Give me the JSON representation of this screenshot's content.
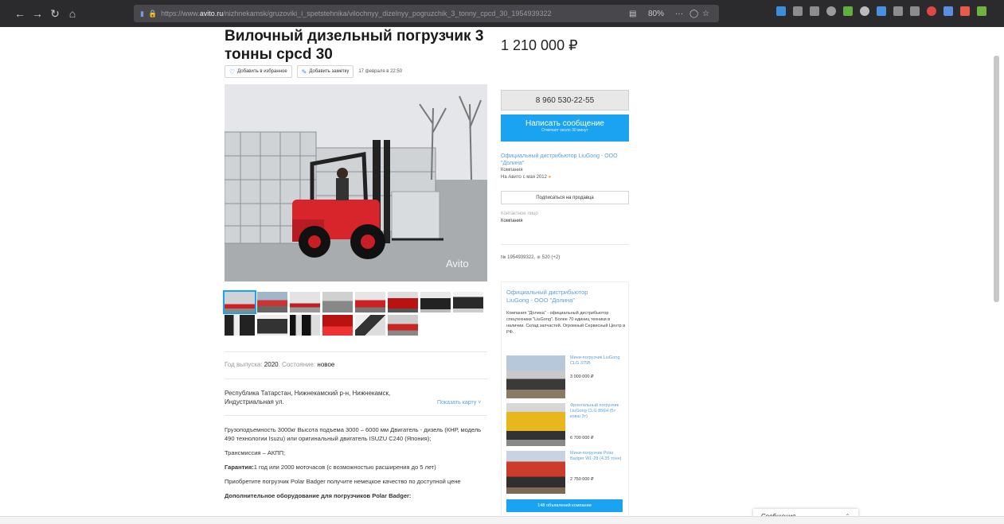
{
  "browser": {
    "url_prefix": "https://www.",
    "url_domain": "avito.ru",
    "url_rest": "/nizhnekamsk/gruzoviki_i_spetstehnika/vilochnyy_dizelnyy_pogruzchik_3_tonny_cpcd_30_1954939322",
    "zoom": "80%",
    "menu": "···"
  },
  "listing": {
    "title": "Вилочный дизельный погрузчик 3 тонны cpcd 30",
    "price": "1 210 000 ₽",
    "favorite_label": "Добавить в избранное",
    "note_label": "Добавить заметку",
    "date": "17 февраля в 22:50",
    "watermark": "Avito",
    "specs": {
      "year_label": "Год выпуска:",
      "year_value": "2020",
      "condition_label": "Состояние:",
      "condition_value": "новое"
    },
    "address": "Республика Татарстан, Нижнекамский р-н, Нижнекамск, Индустриальная ул.",
    "map_link": "Показать карту",
    "description": [
      "Грузоподъемность 3000кг Высота подъема 3000 – 6000 мм Двигатель - дизель (КНР, модель 490 технологии Isuzu) или оригинальный двигатель ISUZU C240 (Япония);",
      "Трансмиссия – АКПП;",
      "1 год или 2000 моточасов (с возможностью расширения до 5 лет)",
      "Приобретите погрузчик Polar Badger получите немецкое качество по доступной цене",
      "Дополнительное оборудование для погрузчиков Polar Badger:"
    ],
    "warranty_label": "Гарантия:"
  },
  "seller": {
    "phone": "8 960 530-22-55",
    "message_button": "Написать сообщение",
    "message_sub": "Отвечает около 30 минут",
    "name": "Официальный дистрибьютор LiuGong - ООО \"Долина\"",
    "type": "Компания",
    "since": "На Авито с мая 2012",
    "subscribe": "Подписаться на продавца",
    "contact_label": "Контактное лицо",
    "contact_value": "Компания",
    "ad_number": "№ 1954939322,",
    "views": "520 (+2)"
  },
  "promo": {
    "title": "Официальный дистрибьютор LiuGong - ООО \"Долина\"",
    "description": "Компания \"Долина\" - официальный дистрибьютор спецтехники \"LiuGong\". Более 70 единиц техники в наличии. Склад запчастей. Огромный Сервисный Центр в РФ.",
    "items": [
      {
        "name": "Мини-погрузчик LiuGong CLG 375B",
        "price": "3 000 000 ₽"
      },
      {
        "name": "Фронтальный погрузчик LiuGong CLG 856H (5т ковш 3т)",
        "price": "6 700 000 ₽"
      },
      {
        "name": "Мини-погрузчик Polar Badger WL-28 (4.35 тонн)",
        "price": "2 750 000 ₽"
      }
    ],
    "all_button": "148 объявлений компании"
  },
  "messages_panel": "Сообщения"
}
